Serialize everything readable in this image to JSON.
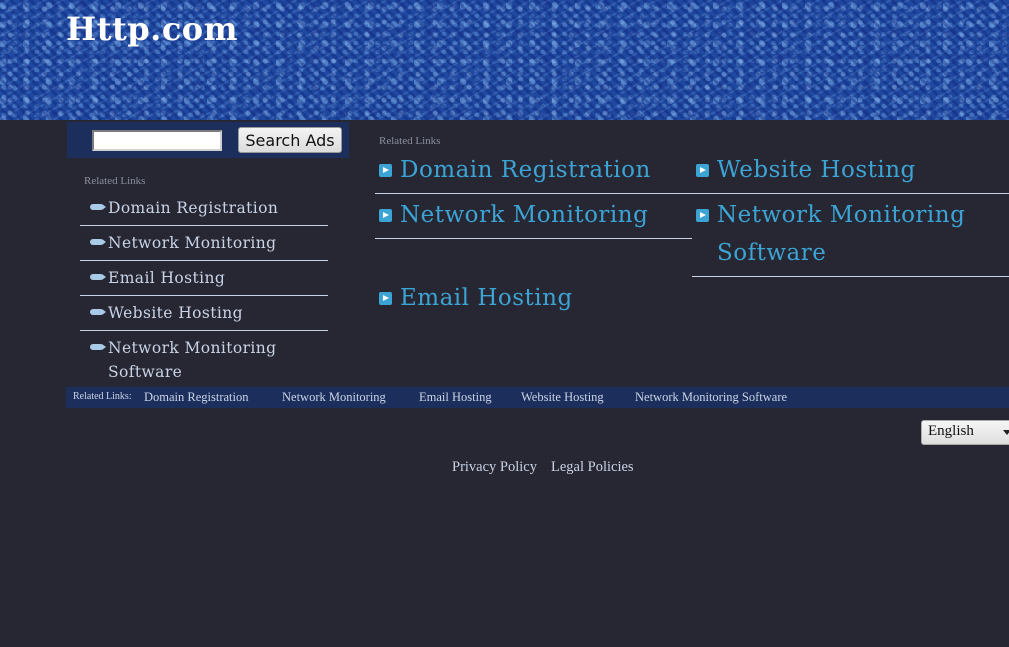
{
  "header": {
    "site_title": "Http.com"
  },
  "search": {
    "button_label": "Search Ads",
    "value": ""
  },
  "sidebar": {
    "heading": "Related Links",
    "items": [
      {
        "label": "Domain Registration"
      },
      {
        "label": "Network Monitoring"
      },
      {
        "label": "Email Hosting"
      },
      {
        "label": "Website Hosting"
      },
      {
        "label": "Network Monitoring Software"
      }
    ]
  },
  "main": {
    "heading": "Related Links",
    "links": [
      {
        "label": "Domain Registration"
      },
      {
        "label": "Website Hosting"
      },
      {
        "label": "Network Monitoring"
      },
      {
        "label": "Network Monitoring Software"
      },
      {
        "label": "Email Hosting"
      }
    ]
  },
  "related_bar": {
    "label": "Related Links:",
    "links": [
      {
        "label": "Domain Registration"
      },
      {
        "label": "Network Monitoring"
      },
      {
        "label": "Email Hosting"
      },
      {
        "label": "Website Hosting"
      },
      {
        "label": "Network Monitoring Software"
      }
    ]
  },
  "language": {
    "selected": "English"
  },
  "footer": {
    "privacy": "Privacy Policy",
    "legal": "Legal Policies"
  },
  "colors": {
    "background": "#272733",
    "link_blue": "#3ca4d4",
    "bar_navy": "#1c2f5c"
  }
}
